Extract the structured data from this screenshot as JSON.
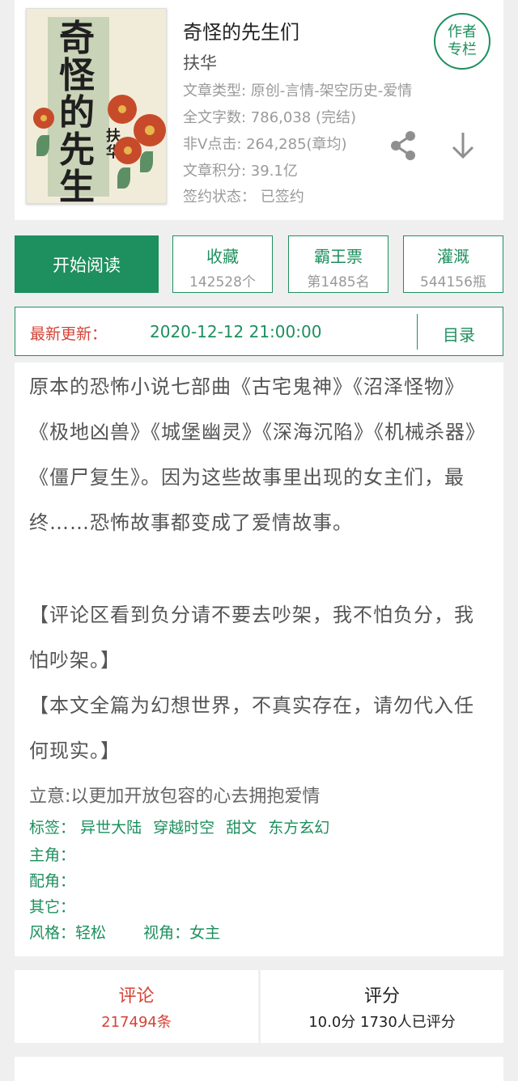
{
  "book": {
    "title": "奇怪的先生们",
    "author": "扶华",
    "cover_title": "奇怪的先生們",
    "cover_author": "扶华",
    "meta": {
      "type": "文章类型: 原创-言情-架空历史-爱情",
      "words": "全文字数: 786,038 (完结)",
      "clicks": "非V点击: 264,285(章均)",
      "score": "文章积分: 39.1亿",
      "contract": "签约状态： 已签约"
    },
    "author_column_label": "作者\n专栏"
  },
  "actions": {
    "start_label": "开始阅读",
    "favorite": {
      "label": "收藏",
      "value": "142528个"
    },
    "tickets": {
      "label": "霸王票",
      "value": "第1485名"
    },
    "watering": {
      "label": "灌溉",
      "value": "544156瓶"
    }
  },
  "update": {
    "label": "最新更新：",
    "time": "2020-12-12 21:00:00",
    "toc_label": "目录"
  },
  "synopsis": {
    "paragraphs": [
      "原本的恐怖小说七部曲《古宅鬼神》《沼泽怪物》《极地凶兽》《城堡幽灵》《深海沉陷》《机械杀器》《僵尸复生》。因为这些故事里出现的女主们，最终……恐怖故事都变成了爱情故事。",
      "【评论区看到负分请不要去吵架，我不怕负分，我怕吵架。】",
      "【本文全篇为幻想世界，不真实存在，请勿代入任何现实。】"
    ],
    "idea": "立意:以更加开放包容的心去拥抱爱情",
    "tags_label": "标签：",
    "tags": [
      "异世大陆",
      "穿越时空",
      "甜文",
      "东方玄幻"
    ],
    "protagonist_label": "主角：",
    "supporting_label": "配角：",
    "other_label": "其它：",
    "style_label": "风格：",
    "style_value": "轻松",
    "perspective_label": "视角：",
    "perspective_value": "女主"
  },
  "bottom": {
    "comment_label": "评论",
    "comment_value": "217494条",
    "rating_label": "评分",
    "rating_value": "10.0分 1730人已评分"
  },
  "colors": {
    "accent": "#1e8f5e",
    "highlight": "#d44437"
  }
}
